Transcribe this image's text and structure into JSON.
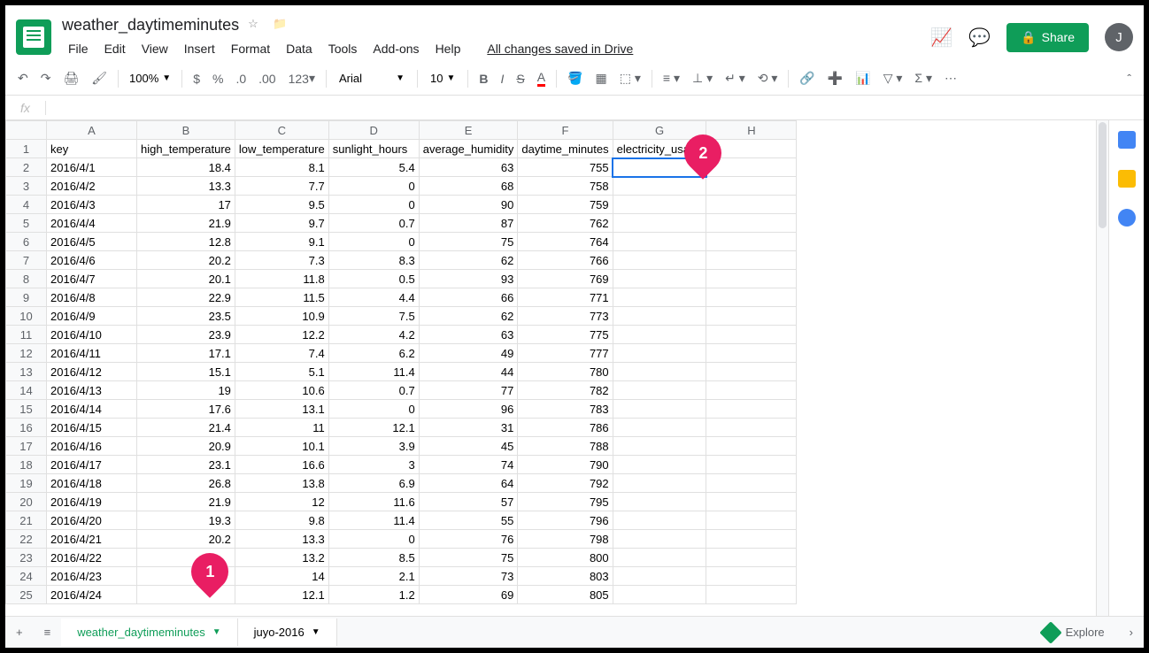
{
  "doc_title": "weather_daytimeminutes",
  "save_status": "All changes saved in Drive",
  "share_label": "Share",
  "avatar_initial": "J",
  "menu": [
    "File",
    "Edit",
    "View",
    "Insert",
    "Format",
    "Data",
    "Tools",
    "Add-ons",
    "Help"
  ],
  "toolbar": {
    "zoom": "100%",
    "font": "Arial",
    "size": "10",
    "more_format": "123"
  },
  "fx_value": "",
  "columns": [
    "A",
    "B",
    "C",
    "D",
    "E",
    "F",
    "G",
    "H"
  ],
  "headers": [
    "key",
    "high_temperature",
    "low_temperature",
    "sunlight_hours",
    "average_humidity",
    "daytime_minutes",
    "electricity_usage",
    ""
  ],
  "rows": [
    {
      "n": 2,
      "c": [
        "2016/4/1",
        "18.4",
        "8.1",
        "5.4",
        "63",
        "755",
        "",
        ""
      ]
    },
    {
      "n": 3,
      "c": [
        "2016/4/2",
        "13.3",
        "7.7",
        "0",
        "68",
        "758",
        "",
        ""
      ]
    },
    {
      "n": 4,
      "c": [
        "2016/4/3",
        "17",
        "9.5",
        "0",
        "90",
        "759",
        "",
        ""
      ]
    },
    {
      "n": 5,
      "c": [
        "2016/4/4",
        "21.9",
        "9.7",
        "0.7",
        "87",
        "762",
        "",
        ""
      ]
    },
    {
      "n": 6,
      "c": [
        "2016/4/5",
        "12.8",
        "9.1",
        "0",
        "75",
        "764",
        "",
        ""
      ]
    },
    {
      "n": 7,
      "c": [
        "2016/4/6",
        "20.2",
        "7.3",
        "8.3",
        "62",
        "766",
        "",
        ""
      ]
    },
    {
      "n": 8,
      "c": [
        "2016/4/7",
        "20.1",
        "11.8",
        "0.5",
        "93",
        "769",
        "",
        ""
      ]
    },
    {
      "n": 9,
      "c": [
        "2016/4/8",
        "22.9",
        "11.5",
        "4.4",
        "66",
        "771",
        "",
        ""
      ]
    },
    {
      "n": 10,
      "c": [
        "2016/4/9",
        "23.5",
        "10.9",
        "7.5",
        "62",
        "773",
        "",
        ""
      ]
    },
    {
      "n": 11,
      "c": [
        "2016/4/10",
        "23.9",
        "12.2",
        "4.2",
        "63",
        "775",
        "",
        ""
      ]
    },
    {
      "n": 12,
      "c": [
        "2016/4/11",
        "17.1",
        "7.4",
        "6.2",
        "49",
        "777",
        "",
        ""
      ]
    },
    {
      "n": 13,
      "c": [
        "2016/4/12",
        "15.1",
        "5.1",
        "11.4",
        "44",
        "780",
        "",
        ""
      ]
    },
    {
      "n": 14,
      "c": [
        "2016/4/13",
        "19",
        "10.6",
        "0.7",
        "77",
        "782",
        "",
        ""
      ]
    },
    {
      "n": 15,
      "c": [
        "2016/4/14",
        "17.6",
        "13.1",
        "0",
        "96",
        "783",
        "",
        ""
      ]
    },
    {
      "n": 16,
      "c": [
        "2016/4/15",
        "21.4",
        "11",
        "12.1",
        "31",
        "786",
        "",
        ""
      ]
    },
    {
      "n": 17,
      "c": [
        "2016/4/16",
        "20.9",
        "10.1",
        "3.9",
        "45",
        "788",
        "",
        ""
      ]
    },
    {
      "n": 18,
      "c": [
        "2016/4/17",
        "23.1",
        "16.6",
        "3",
        "74",
        "790",
        "",
        ""
      ]
    },
    {
      "n": 19,
      "c": [
        "2016/4/18",
        "26.8",
        "13.8",
        "6.9",
        "64",
        "792",
        "",
        ""
      ]
    },
    {
      "n": 20,
      "c": [
        "2016/4/19",
        "21.9",
        "12",
        "11.6",
        "57",
        "795",
        "",
        ""
      ]
    },
    {
      "n": 21,
      "c": [
        "2016/4/20",
        "19.3",
        "9.8",
        "11.4",
        "55",
        "796",
        "",
        ""
      ]
    },
    {
      "n": 22,
      "c": [
        "2016/4/21",
        "20.2",
        "13.3",
        "0",
        "76",
        "798",
        "",
        ""
      ]
    },
    {
      "n": 23,
      "c": [
        "2016/4/22",
        "",
        "13.2",
        "8.5",
        "75",
        "800",
        "",
        ""
      ]
    },
    {
      "n": 24,
      "c": [
        "2016/4/23",
        "",
        "14",
        "2.1",
        "73",
        "803",
        "",
        ""
      ]
    },
    {
      "n": 25,
      "c": [
        "2016/4/24",
        "",
        "12.1",
        "1.2",
        "69",
        "805",
        "",
        ""
      ]
    }
  ],
  "tabs": [
    {
      "label": "weather_daytimeminutes",
      "active": true
    },
    {
      "label": "juyo-2016",
      "active": false
    }
  ],
  "explore_label": "Explore",
  "pins": {
    "p1": "1",
    "p2": "2"
  }
}
